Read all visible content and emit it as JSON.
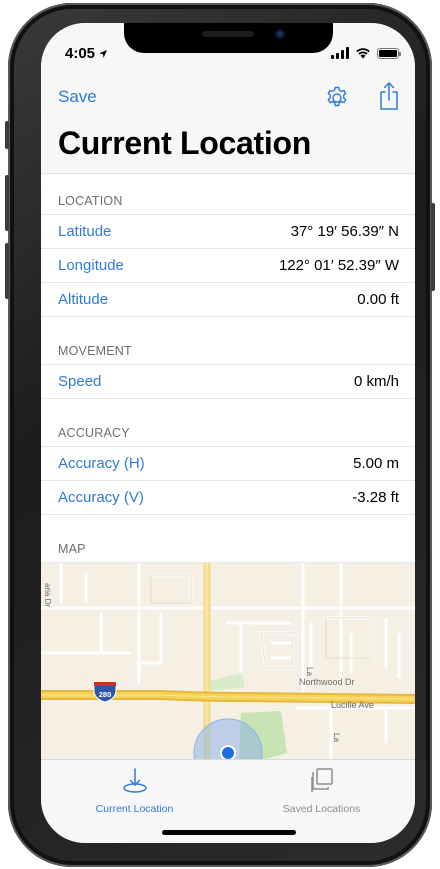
{
  "status_bar": {
    "time": "4:05"
  },
  "nav": {
    "save_label": "Save",
    "title": "Current Location"
  },
  "sections": {
    "location": {
      "header": "LOCATION",
      "rows": [
        {
          "label": "Latitude",
          "value": "37° 19′ 56.39″ N"
        },
        {
          "label": "Longitude",
          "value": "122° 01′ 52.39″ W"
        },
        {
          "label": "Altitude",
          "value": "0.00 ft"
        }
      ]
    },
    "movement": {
      "header": "MOVEMENT",
      "rows": [
        {
          "label": "Speed",
          "value": "0 km/h"
        }
      ]
    },
    "accuracy": {
      "header": "ACCURACY",
      "rows": [
        {
          "label": "Accuracy (H)",
          "value": "5.00 m"
        },
        {
          "label": "Accuracy (V)",
          "value": "-3.28 ft"
        }
      ]
    },
    "map": {
      "header": "MAP",
      "labels": {
        "street_1": "Northwood Dr",
        "street_2": "Lucille Ave",
        "highway_shield": "280",
        "side_street_1": "aria Dr",
        "side_street_2": "La",
        "side_street_3": "La"
      }
    }
  },
  "tab_bar": {
    "tabs": [
      {
        "label": "Current Location",
        "icon": "location-download-icon",
        "active": true
      },
      {
        "label": "Saved Locations",
        "icon": "stacked-squares-icon",
        "active": false
      }
    ]
  },
  "colors": {
    "accent": "#2f7bd6",
    "inactive": "#8e8e93",
    "map_land": "#f5efe4",
    "map_highway": "#f6d25a",
    "map_park": "#c8e3b4"
  }
}
